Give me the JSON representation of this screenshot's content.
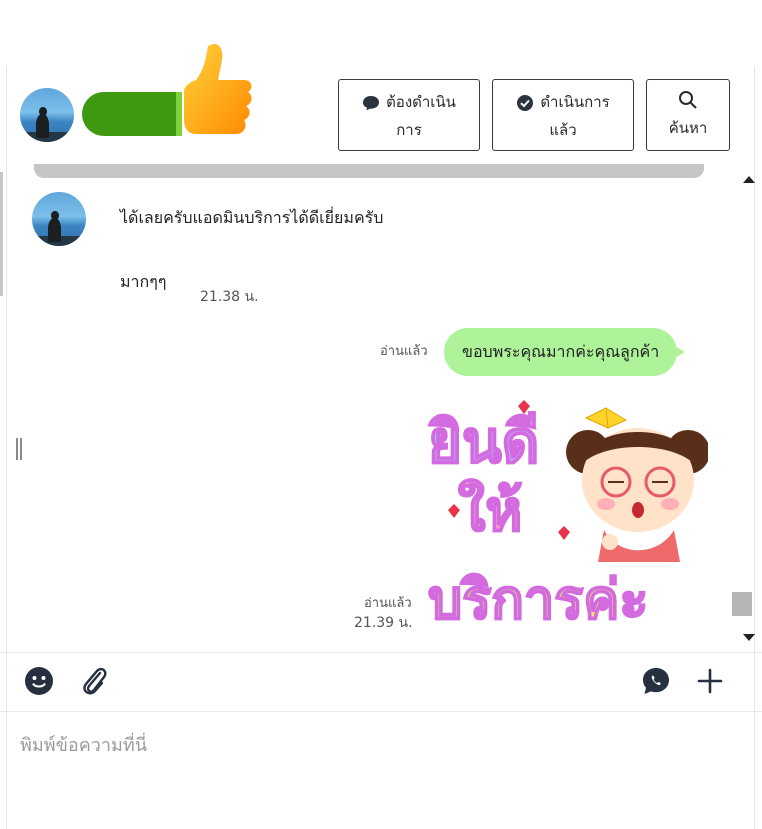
{
  "header": {
    "buttons": [
      {
        "label_line1": "ต้องดำเนิน",
        "label_line2": "การ",
        "icon": "chat-bubble-icon"
      },
      {
        "label_line1": "ดำเนินการ",
        "label_line2": "แล้ว",
        "icon": "check-circle-icon"
      },
      {
        "label_line1": "",
        "label_line2": "ค้นหา",
        "icon": "search-icon"
      }
    ]
  },
  "messages": {
    "incoming": {
      "text_line1": "ได้เลยครับแอดมินบริการได้ดีเยี่ยมครับ",
      "text_line2": "มากๆๆ",
      "time": "21.38 น."
    },
    "outgoing_text": {
      "read_label": "อ่านแล้ว",
      "text": "ขอบพระคุณมากค่ะคุณลูกค้า"
    },
    "outgoing_sticker": {
      "read_label": "อ่านแล้ว",
      "time": "21.39 น.",
      "sticker_text_1": "ยินดี",
      "sticker_text_2": "ให้",
      "sticker_text_3": "บริการค่ะ"
    }
  },
  "composer": {
    "placeholder": "พิมพ์ข้อความที่นี่"
  },
  "colors": {
    "bubble": "#aef39a",
    "redaction": "#3f9a12",
    "border": "#3c3c3c"
  }
}
